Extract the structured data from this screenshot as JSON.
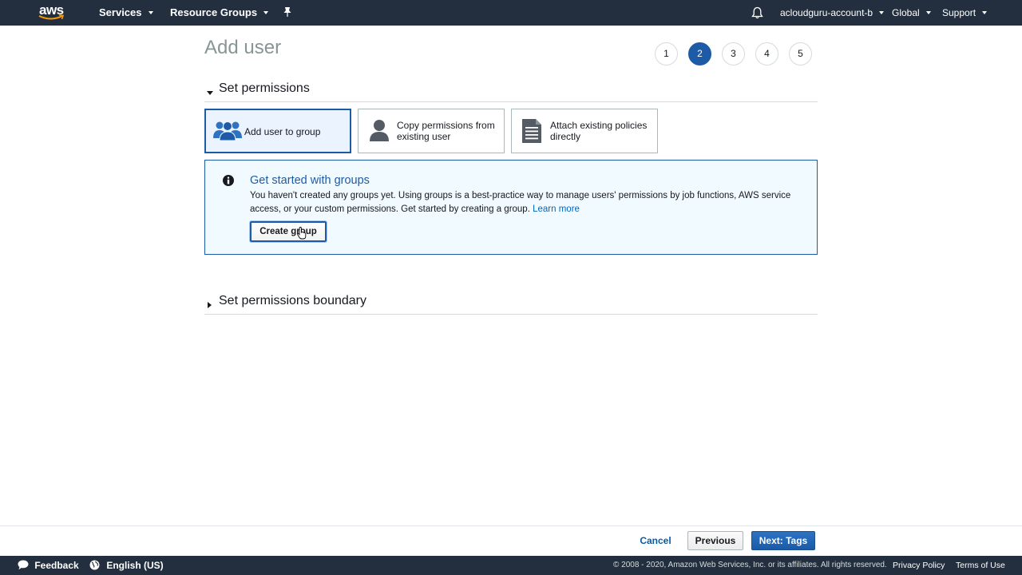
{
  "topnav": {
    "logo_text": "aws",
    "services": "Services",
    "resource_groups": "Resource Groups",
    "account": "acloudguru-account-b",
    "region": "Global",
    "support": "Support"
  },
  "page": {
    "title": "Add user",
    "steps": [
      "1",
      "2",
      "3",
      "4",
      "5"
    ],
    "active_step": "2"
  },
  "permissions": {
    "section_title": "Set permissions",
    "options": [
      {
        "label": "Add user to group",
        "icon": "group-icon",
        "selected": true
      },
      {
        "label": "Copy permissions from existing user",
        "icon": "user-icon",
        "selected": false
      },
      {
        "label": "Attach existing policies directly",
        "icon": "document-icon",
        "selected": false
      }
    ]
  },
  "info": {
    "title": "Get started with groups",
    "text": "You haven't created any groups yet. Using groups is a best-practice way to manage users' permissions by job functions, AWS service access, or your custom permissions. Get started by creating a group.",
    "link": "Learn more",
    "button": "Create group"
  },
  "boundary": {
    "section_title": "Set permissions boundary"
  },
  "actions": {
    "cancel": "Cancel",
    "previous": "Previous",
    "next": "Next: Tags"
  },
  "footer": {
    "feedback": "Feedback",
    "language": "English (US)",
    "copyright": "© 2008 - 2020, Amazon Web Services, Inc. or its affiliates. All rights reserved.",
    "privacy": "Privacy Policy",
    "terms": "Terms of Use"
  },
  "colors": {
    "nav_bg": "#232f3e",
    "accent": "#1e5ba6",
    "info_bg": "#f1faff"
  }
}
